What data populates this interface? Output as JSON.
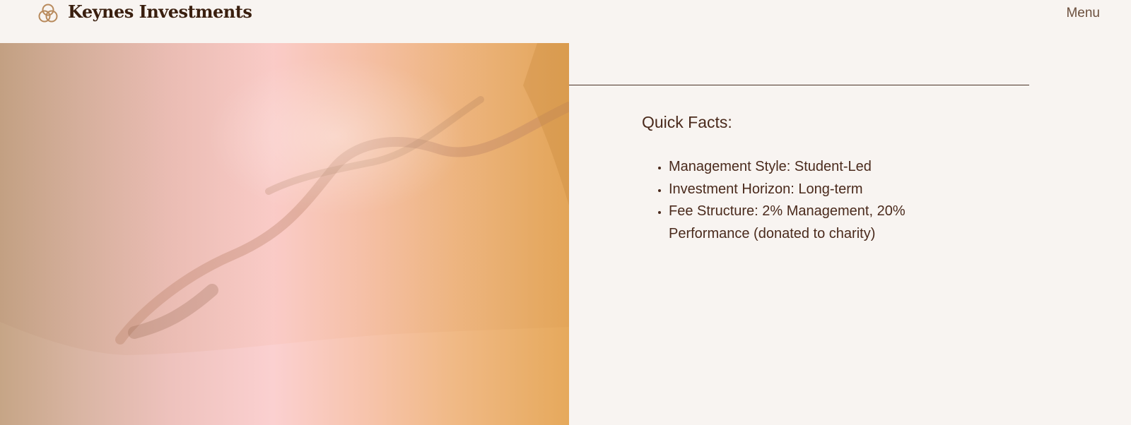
{
  "header": {
    "brand": "Keynes Investments",
    "menu_label": "Menu",
    "logo_icon": "interlocking-circles-icon",
    "accent": "#b88a5c"
  },
  "hero": {
    "image": "silk-fabric-gradient",
    "colors": [
      "#c6a586",
      "#fbd0d0",
      "#e6a95c"
    ]
  },
  "facts": {
    "heading": "Quick Facts:",
    "items": [
      "Management Style: Student-Led",
      "Investment Horizon: Long-term",
      "Fee Structure: 2% Management, 20% Performance (donated to charity)"
    ]
  }
}
